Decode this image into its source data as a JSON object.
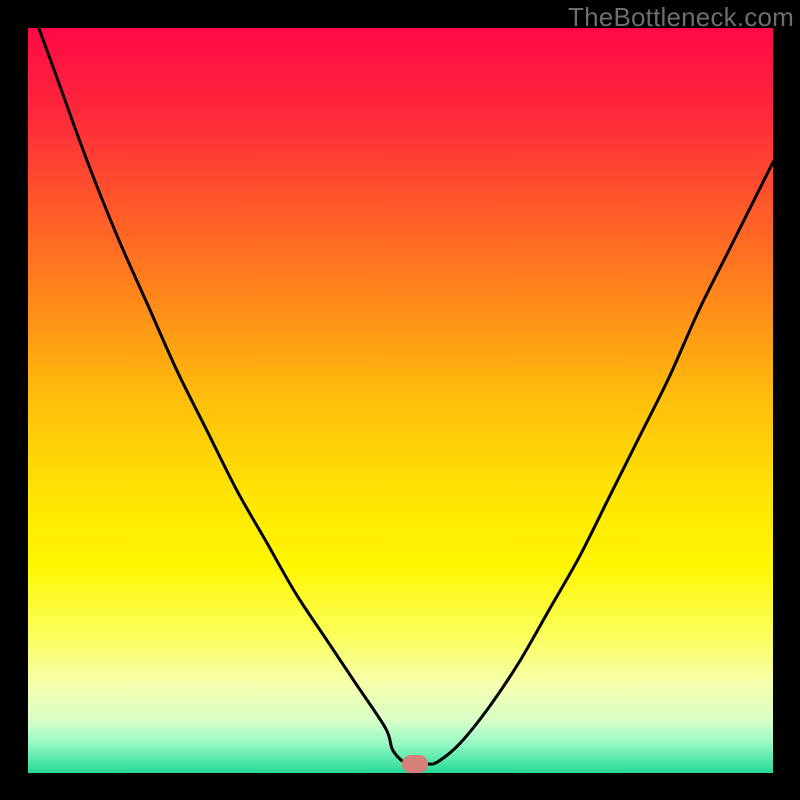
{
  "watermark": "TheBottleneck.com",
  "chart_data": {
    "type": "line",
    "title": "",
    "xlabel": "",
    "ylabel": "",
    "xlim": [
      0,
      100
    ],
    "ylim": [
      0,
      100
    ],
    "gradient_stops": [
      {
        "offset": 0.0,
        "color": "#ff0946"
      },
      {
        "offset": 0.12,
        "color": "#ff2a3a"
      },
      {
        "offset": 0.3,
        "color": "#ff6f22"
      },
      {
        "offset": 0.5,
        "color": "#ffbf0b"
      },
      {
        "offset": 0.62,
        "color": "#ffe304"
      },
      {
        "offset": 0.72,
        "color": "#fff700"
      },
      {
        "offset": 0.82,
        "color": "#fbff61"
      },
      {
        "offset": 0.88,
        "color": "#f6ffad"
      },
      {
        "offset": 0.93,
        "color": "#d8ffc8"
      },
      {
        "offset": 0.96,
        "color": "#97f8c4"
      },
      {
        "offset": 0.985,
        "color": "#4fe6a9"
      },
      {
        "offset": 1.0,
        "color": "#25d894"
      }
    ],
    "series": [
      {
        "name": "bottleneck-curve",
        "x": [
          0,
          4,
          8,
          12,
          16,
          20,
          24,
          28,
          32,
          36,
          40,
          44,
          48,
          49,
          51,
          53.5,
          55,
          58,
          62,
          66,
          70,
          74,
          78,
          82,
          86,
          90,
          94,
          98,
          100
        ],
        "y": [
          104,
          93,
          82,
          72,
          63,
          54,
          46,
          38,
          31,
          24,
          18,
          12,
          6,
          3,
          1.2,
          1.2,
          1.5,
          4,
          9,
          15,
          22,
          29,
          37,
          45,
          53,
          62,
          70,
          78,
          82
        ]
      }
    ],
    "marker": {
      "x": 52,
      "y": 1.2
    },
    "curve_stroke": "#000000",
    "curve_stroke_width": 3
  }
}
